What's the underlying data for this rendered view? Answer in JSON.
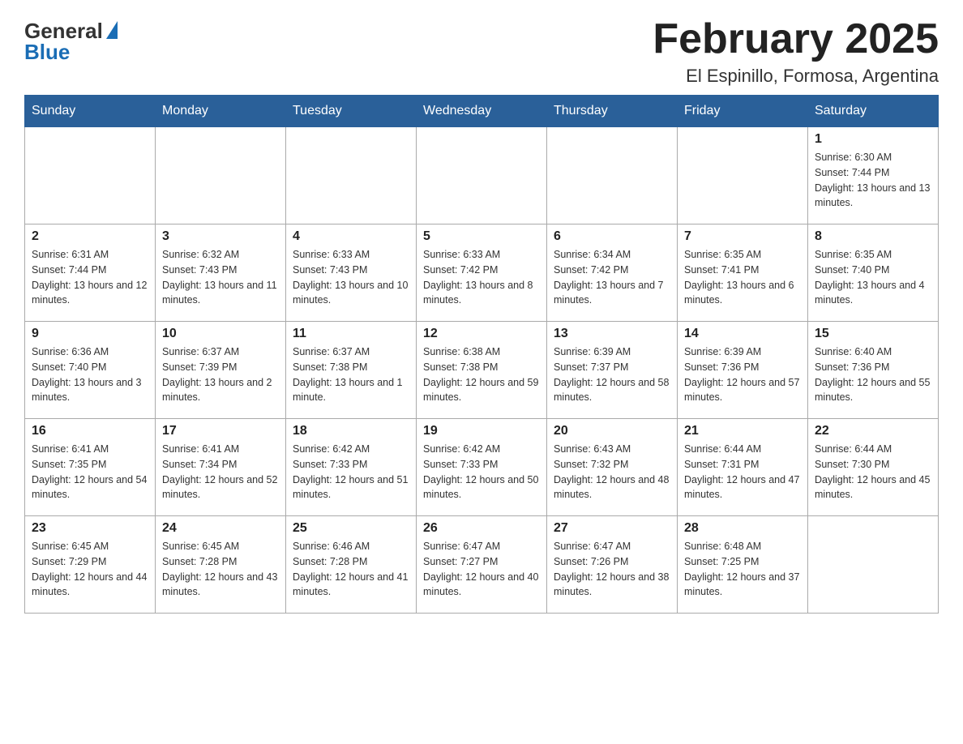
{
  "header": {
    "logo_general": "General",
    "logo_blue": "Blue",
    "title": "February 2025",
    "subtitle": "El Espinillo, Formosa, Argentina"
  },
  "days_of_week": [
    "Sunday",
    "Monday",
    "Tuesday",
    "Wednesday",
    "Thursday",
    "Friday",
    "Saturday"
  ],
  "weeks": [
    [
      {
        "day": "",
        "info": ""
      },
      {
        "day": "",
        "info": ""
      },
      {
        "day": "",
        "info": ""
      },
      {
        "day": "",
        "info": ""
      },
      {
        "day": "",
        "info": ""
      },
      {
        "day": "",
        "info": ""
      },
      {
        "day": "1",
        "info": "Sunrise: 6:30 AM\nSunset: 7:44 PM\nDaylight: 13 hours and 13 minutes."
      }
    ],
    [
      {
        "day": "2",
        "info": "Sunrise: 6:31 AM\nSunset: 7:44 PM\nDaylight: 13 hours and 12 minutes."
      },
      {
        "day": "3",
        "info": "Sunrise: 6:32 AM\nSunset: 7:43 PM\nDaylight: 13 hours and 11 minutes."
      },
      {
        "day": "4",
        "info": "Sunrise: 6:33 AM\nSunset: 7:43 PM\nDaylight: 13 hours and 10 minutes."
      },
      {
        "day": "5",
        "info": "Sunrise: 6:33 AM\nSunset: 7:42 PM\nDaylight: 13 hours and 8 minutes."
      },
      {
        "day": "6",
        "info": "Sunrise: 6:34 AM\nSunset: 7:42 PM\nDaylight: 13 hours and 7 minutes."
      },
      {
        "day": "7",
        "info": "Sunrise: 6:35 AM\nSunset: 7:41 PM\nDaylight: 13 hours and 6 minutes."
      },
      {
        "day": "8",
        "info": "Sunrise: 6:35 AM\nSunset: 7:40 PM\nDaylight: 13 hours and 4 minutes."
      }
    ],
    [
      {
        "day": "9",
        "info": "Sunrise: 6:36 AM\nSunset: 7:40 PM\nDaylight: 13 hours and 3 minutes."
      },
      {
        "day": "10",
        "info": "Sunrise: 6:37 AM\nSunset: 7:39 PM\nDaylight: 13 hours and 2 minutes."
      },
      {
        "day": "11",
        "info": "Sunrise: 6:37 AM\nSunset: 7:38 PM\nDaylight: 13 hours and 1 minute."
      },
      {
        "day": "12",
        "info": "Sunrise: 6:38 AM\nSunset: 7:38 PM\nDaylight: 12 hours and 59 minutes."
      },
      {
        "day": "13",
        "info": "Sunrise: 6:39 AM\nSunset: 7:37 PM\nDaylight: 12 hours and 58 minutes."
      },
      {
        "day": "14",
        "info": "Sunrise: 6:39 AM\nSunset: 7:36 PM\nDaylight: 12 hours and 57 minutes."
      },
      {
        "day": "15",
        "info": "Sunrise: 6:40 AM\nSunset: 7:36 PM\nDaylight: 12 hours and 55 minutes."
      }
    ],
    [
      {
        "day": "16",
        "info": "Sunrise: 6:41 AM\nSunset: 7:35 PM\nDaylight: 12 hours and 54 minutes."
      },
      {
        "day": "17",
        "info": "Sunrise: 6:41 AM\nSunset: 7:34 PM\nDaylight: 12 hours and 52 minutes."
      },
      {
        "day": "18",
        "info": "Sunrise: 6:42 AM\nSunset: 7:33 PM\nDaylight: 12 hours and 51 minutes."
      },
      {
        "day": "19",
        "info": "Sunrise: 6:42 AM\nSunset: 7:33 PM\nDaylight: 12 hours and 50 minutes."
      },
      {
        "day": "20",
        "info": "Sunrise: 6:43 AM\nSunset: 7:32 PM\nDaylight: 12 hours and 48 minutes."
      },
      {
        "day": "21",
        "info": "Sunrise: 6:44 AM\nSunset: 7:31 PM\nDaylight: 12 hours and 47 minutes."
      },
      {
        "day": "22",
        "info": "Sunrise: 6:44 AM\nSunset: 7:30 PM\nDaylight: 12 hours and 45 minutes."
      }
    ],
    [
      {
        "day": "23",
        "info": "Sunrise: 6:45 AM\nSunset: 7:29 PM\nDaylight: 12 hours and 44 minutes."
      },
      {
        "day": "24",
        "info": "Sunrise: 6:45 AM\nSunset: 7:28 PM\nDaylight: 12 hours and 43 minutes."
      },
      {
        "day": "25",
        "info": "Sunrise: 6:46 AM\nSunset: 7:28 PM\nDaylight: 12 hours and 41 minutes."
      },
      {
        "day": "26",
        "info": "Sunrise: 6:47 AM\nSunset: 7:27 PM\nDaylight: 12 hours and 40 minutes."
      },
      {
        "day": "27",
        "info": "Sunrise: 6:47 AM\nSunset: 7:26 PM\nDaylight: 12 hours and 38 minutes."
      },
      {
        "day": "28",
        "info": "Sunrise: 6:48 AM\nSunset: 7:25 PM\nDaylight: 12 hours and 37 minutes."
      },
      {
        "day": "",
        "info": ""
      }
    ]
  ]
}
